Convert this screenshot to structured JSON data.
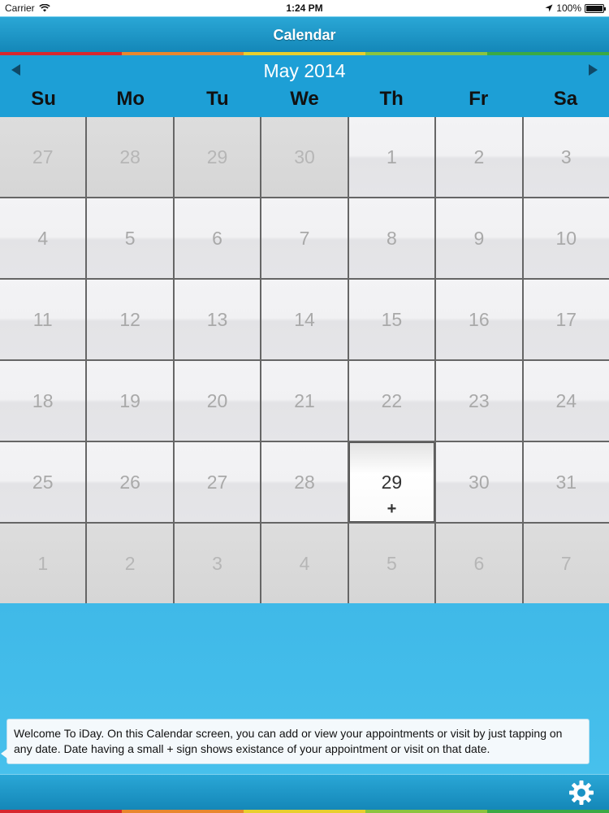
{
  "status_bar": {
    "carrier": "Carrier",
    "time": "1:24 PM",
    "battery": "100%"
  },
  "nav": {
    "title": "Calendar"
  },
  "colors": {
    "stripe": [
      "#d7282f",
      "#e8872e",
      "#e8cf2e",
      "#8bc43f",
      "#3aa945"
    ],
    "accent": "#1d9fd6"
  },
  "month": {
    "title": "May 2014"
  },
  "weekdays": [
    "Su",
    "Mo",
    "Tu",
    "We",
    "Th",
    "Fr",
    "Sa"
  ],
  "weeks": [
    [
      "27",
      "28",
      "29",
      "30",
      "1",
      "2",
      "3"
    ],
    [
      "4",
      "5",
      "6",
      "7",
      "8",
      "9",
      "10"
    ],
    [
      "11",
      "12",
      "13",
      "14",
      "15",
      "16",
      "17"
    ],
    [
      "18",
      "19",
      "20",
      "21",
      "22",
      "23",
      "24"
    ],
    [
      "25",
      "26",
      "27",
      "28",
      "29",
      "30",
      "31"
    ],
    [
      "1",
      "2",
      "3",
      "4",
      "5",
      "6",
      "7"
    ]
  ],
  "today": {
    "marker": "+"
  },
  "tooltip": {
    "text": "Welcome To iDay. On this Calendar screen, you can add or view your appointments or visit by just tapping on any date. Date having a small + sign shows existance of your appointment or visit on that date."
  },
  "toolbar": {
    "settings_icon": "gear-icon"
  }
}
